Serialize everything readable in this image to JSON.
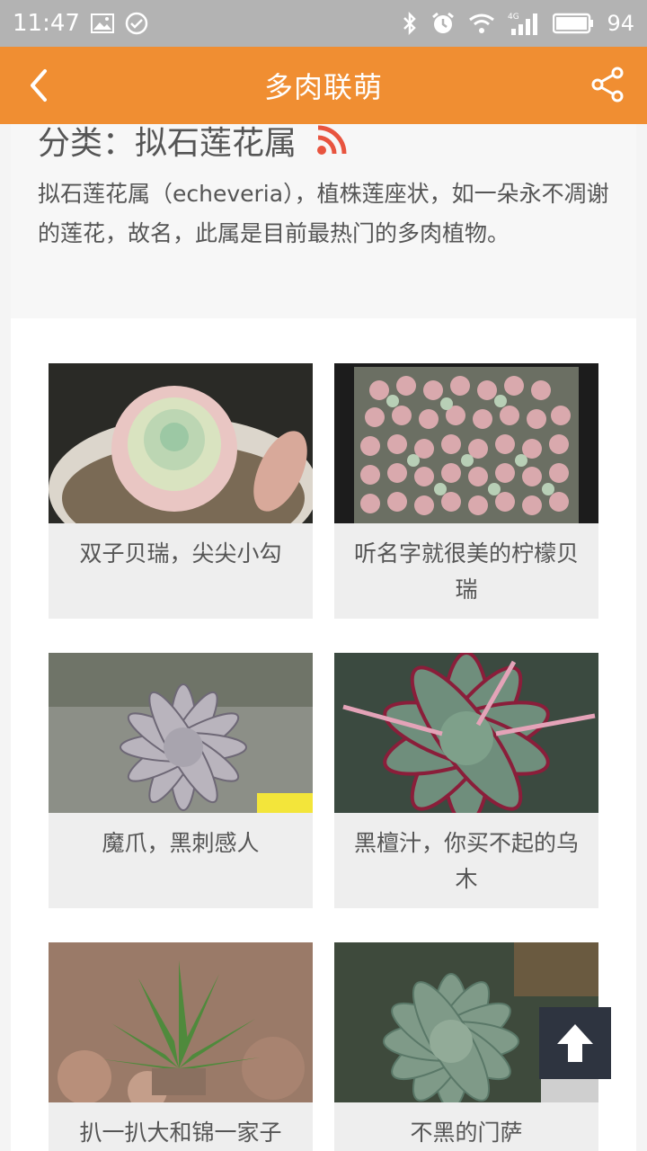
{
  "status_bar": {
    "time": "11:47",
    "battery": "94",
    "network": "4G",
    "icons": [
      "image-icon",
      "check-circle-icon",
      "bluetooth-icon",
      "alarm-icon",
      "wifi-icon",
      "signal-icon",
      "battery-icon"
    ]
  },
  "app_bar": {
    "title": "多肉联萌",
    "back_icon": "chevron-left-icon",
    "share_icon": "share-icon"
  },
  "category": {
    "title": "分类：拟石莲花属",
    "rss_icon": "rss-icon",
    "description": "拟石莲花属（echeveria），植株莲座状，如一朵永不凋谢的莲花，故名，此属是目前最热门的多肉植物。"
  },
  "cards": [
    {
      "caption": "双子贝瑞，尖尖小勾"
    },
    {
      "caption": "听名字就很美的柠檬贝瑞"
    },
    {
      "caption": "魔爪，黑刺感人"
    },
    {
      "caption": "黑檀汁，你买不起的乌木"
    },
    {
      "caption": "扒一扒大和锦一家子"
    },
    {
      "caption": "不黑的门萨"
    }
  ],
  "colors": {
    "accent": "#f08e32",
    "status_bar": "#b3b3b3",
    "rss": "#e8543f",
    "scroll_button": "#2e3440"
  },
  "scroll_top_icon": "arrow-up-icon"
}
